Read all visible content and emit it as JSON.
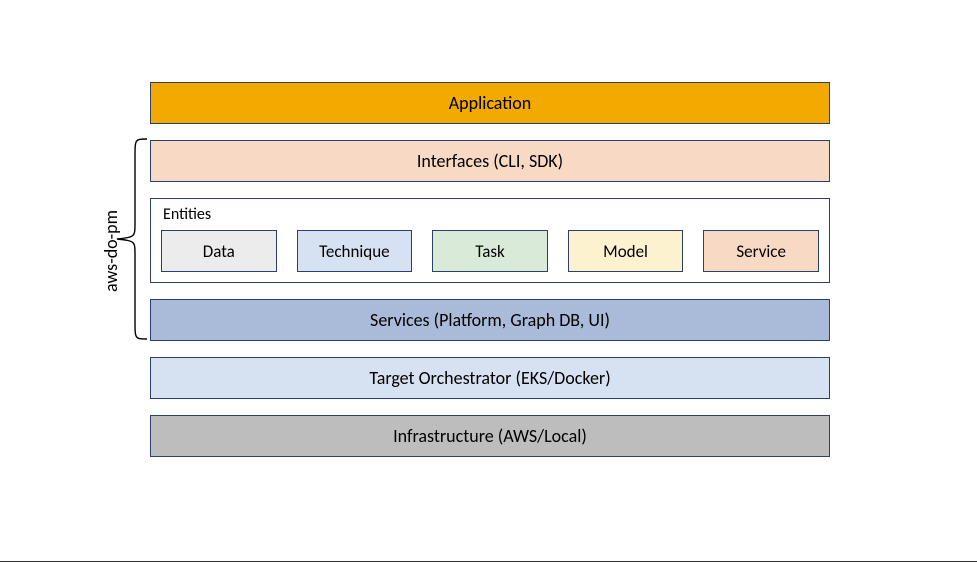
{
  "sideLabel": "aws-do-pm",
  "layers": {
    "application": "Application",
    "interfaces": "Interfaces (CLI, SDK)",
    "entitiesTitle": "Entities",
    "entities": {
      "data": "Data",
      "technique": "Technique",
      "task": "Task",
      "model": "Model",
      "service": "Service"
    },
    "services": "Services (Platform, Graph DB, UI)",
    "target": "Target Orchestrator (EKS/Docker)",
    "infrastructure": "Infrastructure (AWS/Local)"
  },
  "colors": {
    "application": "#f2a900",
    "interfaces": "#f7d9c4",
    "entityData": "#ececec",
    "entityTechnique": "#d6e1f1",
    "entityTask": "#daead8",
    "entityModel": "#fdf2d0",
    "entityService": "#f7d9c4",
    "services": "#a9bbd9",
    "target": "#d6e1f1",
    "infrastructure": "#bdbdbd",
    "border": "#2a3f6b"
  }
}
